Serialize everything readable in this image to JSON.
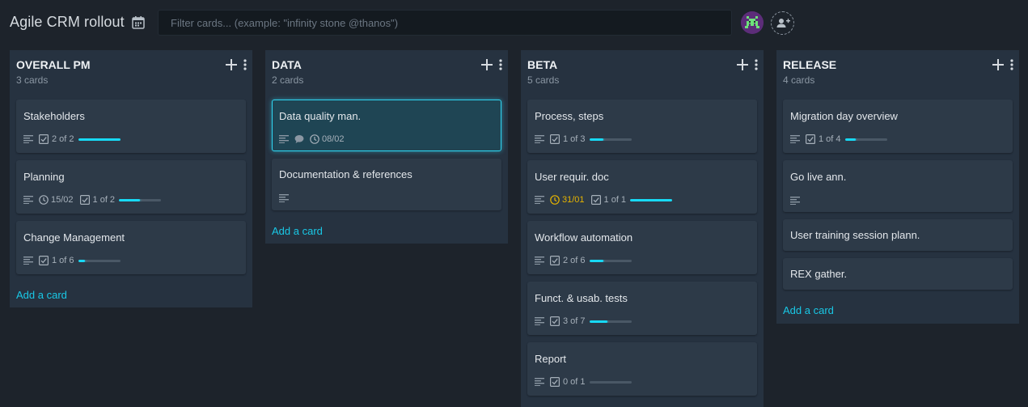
{
  "board": {
    "title": "Agile CRM rollout",
    "filter_placeholder": "Filter cards... (example: \"infinity stone @thanos\")",
    "calendar_icon": "calendar-icon",
    "add_member_icon": "add-member-icon"
  },
  "colors": {
    "accent": "#17d9f5",
    "due_warning": "#e6b400",
    "avatar_bg": "#5c2d79",
    "avatar_fg": "#6ee27a"
  },
  "lists": [
    {
      "title": "OVERALL PM",
      "count": "3 cards",
      "add_card": "Add a card",
      "cards": [
        {
          "title": "Stakeholders",
          "checklist": "2 of 2",
          "progress": 1.0
        },
        {
          "title": "Planning",
          "due": "15/02",
          "checklist": "1 of 2",
          "progress": 0.5
        },
        {
          "title": "Change Management",
          "checklist": "1 of 6",
          "progress": 0.17
        }
      ]
    },
    {
      "title": "DATA",
      "count": "2 cards",
      "add_card": "Add a card",
      "cards": [
        {
          "title": "Data quality man.",
          "comment": true,
          "due": "08/02",
          "active": true
        },
        {
          "title": "Documentation & references"
        }
      ]
    },
    {
      "title": "BETA",
      "count": "5 cards",
      "cards": [
        {
          "title": "Process, steps",
          "checklist": "1 of 3",
          "progress": 0.33
        },
        {
          "title": "User requir. doc",
          "due": "31/01",
          "due_warning": true,
          "checklist": "1 of 1",
          "progress": 1.0
        },
        {
          "title": "Workflow automation",
          "checklist": "2 of 6",
          "progress": 0.33
        },
        {
          "title": "Funct. & usab. tests",
          "checklist": "3 of 7",
          "progress": 0.43
        },
        {
          "title": "Report",
          "checklist": "0 of 1",
          "progress": 0
        }
      ]
    },
    {
      "title": "RELEASE",
      "count": "4 cards",
      "add_card": "Add a card",
      "cards": [
        {
          "title": "Migration day overview",
          "checklist": "1 of 4",
          "progress": 0.25
        },
        {
          "title": "Go live ann."
        },
        {
          "title": "User training session plann."
        },
        {
          "title": "REX gather."
        }
      ]
    }
  ]
}
